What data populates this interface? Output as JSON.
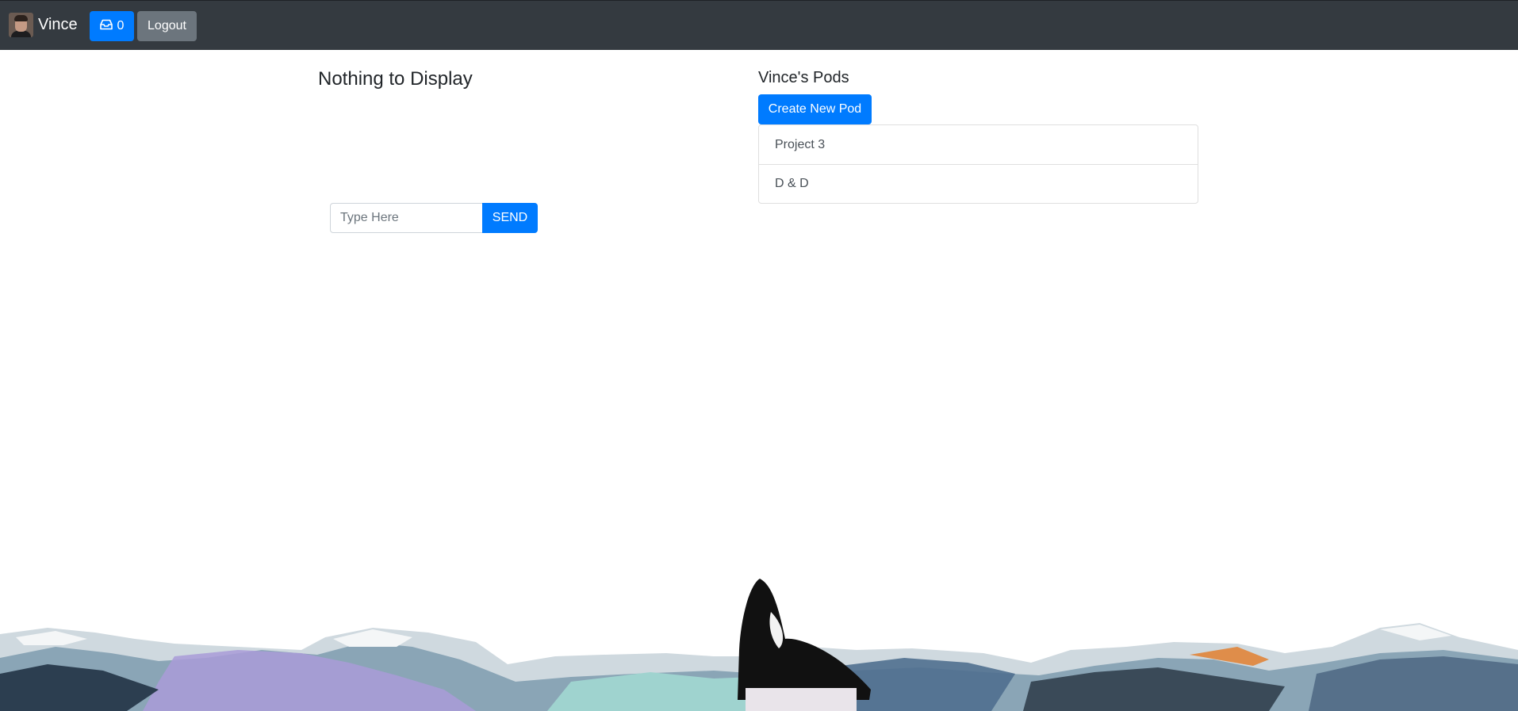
{
  "navbar": {
    "user_name": "Vince",
    "inbox_count": "0",
    "logout_label": "Logout"
  },
  "chat": {
    "empty_title": "Nothing to Display",
    "input_placeholder": "Type Here",
    "send_label": "SEND"
  },
  "pods": {
    "title": "Vince's Pods",
    "create_label": "Create New Pod",
    "items": [
      {
        "label": "Project 3"
      },
      {
        "label": "D & D"
      }
    ]
  },
  "colors": {
    "navbar": "#343a40",
    "primary": "#007bff",
    "secondary": "#6c757d"
  },
  "icons": {
    "inbox": "inbox-icon",
    "avatar": "user-avatar-photo"
  }
}
